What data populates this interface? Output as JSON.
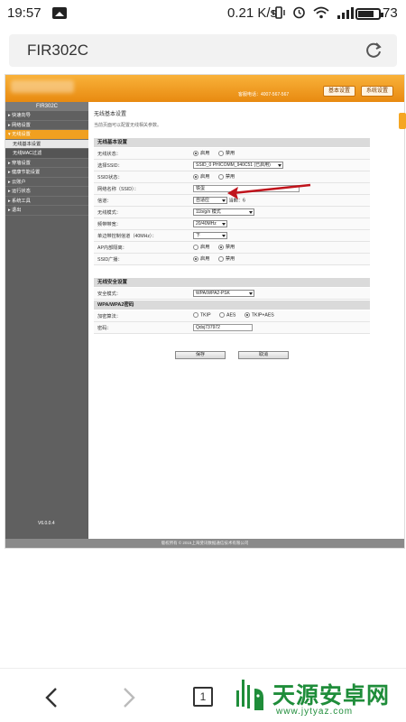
{
  "status_bar": {
    "time": "19:57",
    "speed": "0.21 K/s",
    "battery": "73",
    "icons": [
      "image-icon",
      "vibrate-icon",
      "alarm-icon",
      "wifi-icon",
      "signal-icon",
      "battery-icon"
    ]
  },
  "browser": {
    "url": "FIR302C",
    "tab_count": "1"
  },
  "router": {
    "hotline": "客服电话：4007-567-567",
    "top_buttons": {
      "basic": "基本设置",
      "system": "系统设置"
    },
    "sidebar": {
      "title": "FIR302C",
      "items": [
        "▸ 快速向导",
        "▸ 网络设置",
        "▾ 无线设置",
        "无线基本设置",
        "无线MAC过滤",
        "▸ 穿墙设置",
        "▸ 健康节能设置",
        "▸ 云账户",
        "▸ 运行状态",
        "▸ 系统工具",
        "▸ 退出"
      ],
      "version": "V6.0.0.4"
    },
    "page_title": "无线基本设置",
    "page_desc": "当前页面可以配置无线相关参数。",
    "section_basic": "无线基本设置",
    "rows": {
      "wireless_state": {
        "label": "无线状态：",
        "opt_on": "启用",
        "opt_off": "禁用"
      },
      "select_ssid": {
        "label": "选择SSID：",
        "value": "SSID_0 PHICOMM_940C51 (已启用)"
      },
      "ssid_state": {
        "label": "SSID状态：",
        "opt_on": "启用",
        "opt_off": "禁用"
      },
      "ssid_name": {
        "label": "网络名称（SSID）：",
        "value": "铁蛋"
      },
      "channel": {
        "label": "信道：",
        "value": "自适应",
        "current": "当前：6"
      },
      "mode": {
        "label": "无线模式：",
        "value": "11b/g/n 模式"
      },
      "bandwidth": {
        "label": "频带带宽：",
        "value": "20/40MHz"
      },
      "sideband": {
        "label": "单边带控制信道（40MHz）：",
        "value": "下"
      },
      "ap_isolation": {
        "label": "AP内部隔离：",
        "opt_on": "启用",
        "opt_off": "禁用"
      },
      "ssid_broadcast": {
        "label": "SSID广播：",
        "opt_on": "启用",
        "opt_off": "禁用"
      }
    },
    "section_security": "无线安全设置",
    "security_mode": {
      "label": "安全模式：",
      "value": "WPA/WPA2-PSK"
    },
    "section_wpa": "WPA/WPA2密码",
    "encryption": {
      "label": "加密算法：",
      "opt1": "TKIP",
      "opt2": "AES",
      "opt3": "TKIP+AES"
    },
    "password": {
      "label": "密码：",
      "value": "Qdsj737972"
    },
    "buttons": {
      "save": "保存",
      "cancel": "取消"
    },
    "footer": "版权所有 © 2015上海斐讯数据通信技术有限公司"
  },
  "watermark": {
    "title": "天源安卓网",
    "url": "www.jytyaz.com"
  },
  "colors": {
    "header_orange": "#f5a623",
    "sidebar_gray": "#606060",
    "arrow_red": "#c0141c",
    "watermark_green": "#1f8d3a"
  }
}
